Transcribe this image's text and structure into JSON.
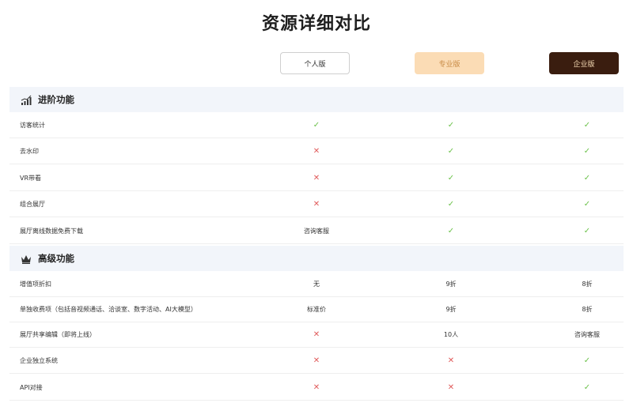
{
  "title": "资源详细对比",
  "plans": {
    "personal": "个人版",
    "pro": "专业版",
    "enterprise": "企业版"
  },
  "colors": {
    "check": "#6cc24a",
    "cross": "#e05a5a",
    "pro_bg": "#fbdcb5",
    "enterprise_bg": "#3a1d0f"
  },
  "icons": {
    "check": "✓",
    "cross": "✕"
  },
  "sections": [
    {
      "label": "进阶功能",
      "icon": "bar-chart-icon",
      "rows": [
        {
          "label": "访客统计",
          "values": [
            "check",
            "check",
            "check"
          ]
        },
        {
          "label": "去水印",
          "values": [
            "cross",
            "check",
            "check"
          ]
        },
        {
          "label": "VR带看",
          "values": [
            "cross",
            "check",
            "check"
          ]
        },
        {
          "label": "组合展厅",
          "values": [
            "cross",
            "check",
            "check"
          ]
        },
        {
          "label": "展厅离线数据免费下载",
          "values": [
            "咨询客服",
            "check",
            "check"
          ]
        }
      ]
    },
    {
      "label": "高级功能",
      "icon": "crown-icon",
      "rows": [
        {
          "label": "增值项折扣",
          "values": [
            "无",
            "9折",
            "8折"
          ]
        },
        {
          "label": "单独收费项（包括音视频通话、洽谈室、数字活动、AI大模型）",
          "values": [
            "标准价",
            "9折",
            "8折"
          ]
        },
        {
          "label": "展厅共享编辑（即将上线）",
          "values": [
            "cross",
            "10人",
            "咨询客服"
          ]
        },
        {
          "label": "企业独立系统",
          "values": [
            "cross",
            "cross",
            "check"
          ]
        },
        {
          "label": "API对接",
          "values": [
            "cross",
            "cross",
            "check"
          ]
        }
      ]
    }
  ]
}
